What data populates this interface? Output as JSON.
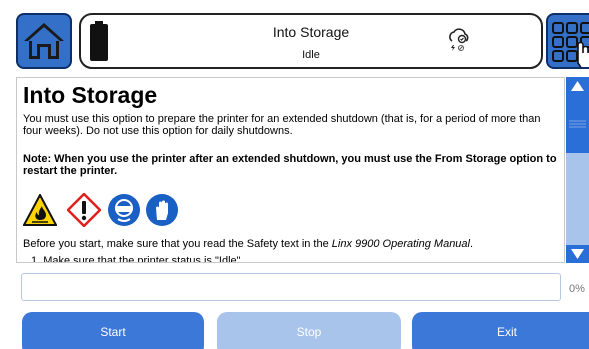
{
  "header": {
    "status_title": "Into Storage",
    "status_state": "Idle"
  },
  "icons": {
    "home": "home-icon",
    "battery": "battery-icon",
    "cloud": "cloud-icon",
    "menu": "grid-menu-icon"
  },
  "content": {
    "title": "Into Storage",
    "intro": "You must use this option to prepare the printer for an extended shutdown (that is, for a period of more than four weeks). Do not use this option for daily shutdowns.",
    "note": "Note: When you use the printer after an extended shutdown, you must use the From Storage option to restart the printer.",
    "before_start_prefix": "Before you start, make sure that you read the Safety text in the ",
    "before_start_manual": "Linx 9900 Operating Manual",
    "before_start_suffix": ".",
    "step1_partial": "1.  Make sure that the printer status is \"Idle\"."
  },
  "progress": {
    "value": 0,
    "label": "0%"
  },
  "buttons": {
    "start": "Start",
    "stop": "Stop",
    "exit": "Exit"
  },
  "colors": {
    "accent": "#3c78d8",
    "accent_disabled": "#a8c4ea",
    "warning_yellow": "#ffd400",
    "ghs_red": "#e0211b",
    "mandatory_blue": "#1a5fc4"
  }
}
